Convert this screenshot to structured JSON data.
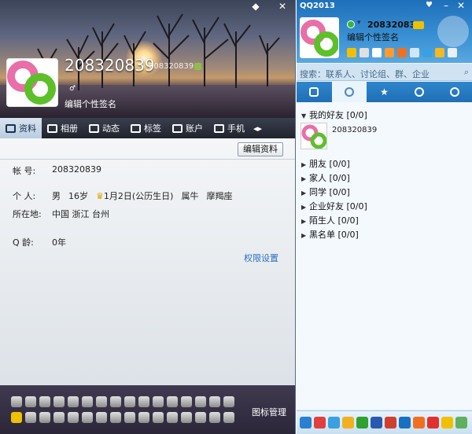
{
  "profile": {
    "uid_large": "208320839",
    "uid_small": "208320839",
    "signature": "编辑个性签名",
    "tabs": [
      {
        "label": "资料",
        "icon": "card-icon",
        "active": true
      },
      {
        "label": "相册",
        "icon": "photo-icon",
        "active": false
      },
      {
        "label": "动态",
        "icon": "feed-icon",
        "active": false
      },
      {
        "label": "标签",
        "icon": "bookmark-icon",
        "active": false
      },
      {
        "label": "账户",
        "icon": "wallet-icon",
        "active": false
      },
      {
        "label": "手机",
        "icon": "phone-icon",
        "active": false
      }
    ],
    "edit_button": "编辑资料",
    "fields": {
      "account_label": "帐    号:",
      "account_value": "208320839",
      "personal_label": "个    人:",
      "gender": "男",
      "age": "16岁",
      "birthday": "1月2日(公历生日)",
      "zodiac": "属牛",
      "constellation": "摩羯座",
      "location_label": "所在地:",
      "location_value": "中国 浙江 台州",
      "qage_label": "Q    龄:",
      "qage_value": "0年"
    },
    "permission_link": "权限设置",
    "icon_manage": "图标管理"
  },
  "qq": {
    "title": "QQ2013",
    "number": "208320839",
    "signature": "编辑个性签名",
    "search_placeholder": "搜索：联系人、讨论组、群、企业",
    "groups": [
      {
        "name": "我的好友",
        "count": "[0/0]",
        "expanded": true
      },
      {
        "name": "朋友",
        "count": "[0/0]",
        "expanded": false
      },
      {
        "name": "家人",
        "count": "[0/0]",
        "expanded": false
      },
      {
        "name": "同学",
        "count": "[0/0]",
        "expanded": false
      },
      {
        "name": "企业好友",
        "count": "[0/0]",
        "expanded": false
      },
      {
        "name": "陌生人",
        "count": "[0/0]",
        "expanded": false
      },
      {
        "name": "黑名单",
        "count": "[0/0]",
        "expanded": false
      }
    ],
    "friend_name": "208320839"
  },
  "colors": {
    "qq_blue": "#2f86cc",
    "link": "#2a6ebf"
  }
}
